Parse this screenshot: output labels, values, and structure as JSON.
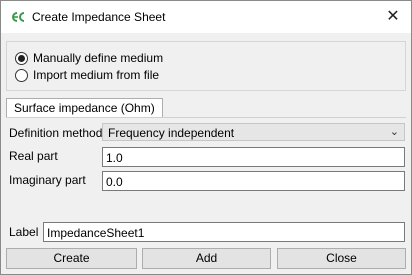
{
  "window": {
    "title": "Create Impedance Sheet",
    "close_symbol": "✕"
  },
  "medium": {
    "options": [
      {
        "label": "Manually define medium",
        "checked": true
      },
      {
        "label": "Import medium from file",
        "checked": false
      }
    ]
  },
  "tab": {
    "label": "Surface impedance (Ohm)"
  },
  "definition_method": {
    "label": "Definition method",
    "value": "Frequency independent",
    "chevron": "⌄"
  },
  "real_part": {
    "label": "Real part",
    "value": "1.0"
  },
  "imaginary_part": {
    "label": "Imaginary part",
    "value": "0.0"
  },
  "label_field": {
    "label": "Label",
    "value": "ImpedanceSheet1"
  },
  "buttons": {
    "create": "Create",
    "add": "Add",
    "close": "Close"
  },
  "colors": {
    "app_icon_green": "#3a9a4a"
  }
}
